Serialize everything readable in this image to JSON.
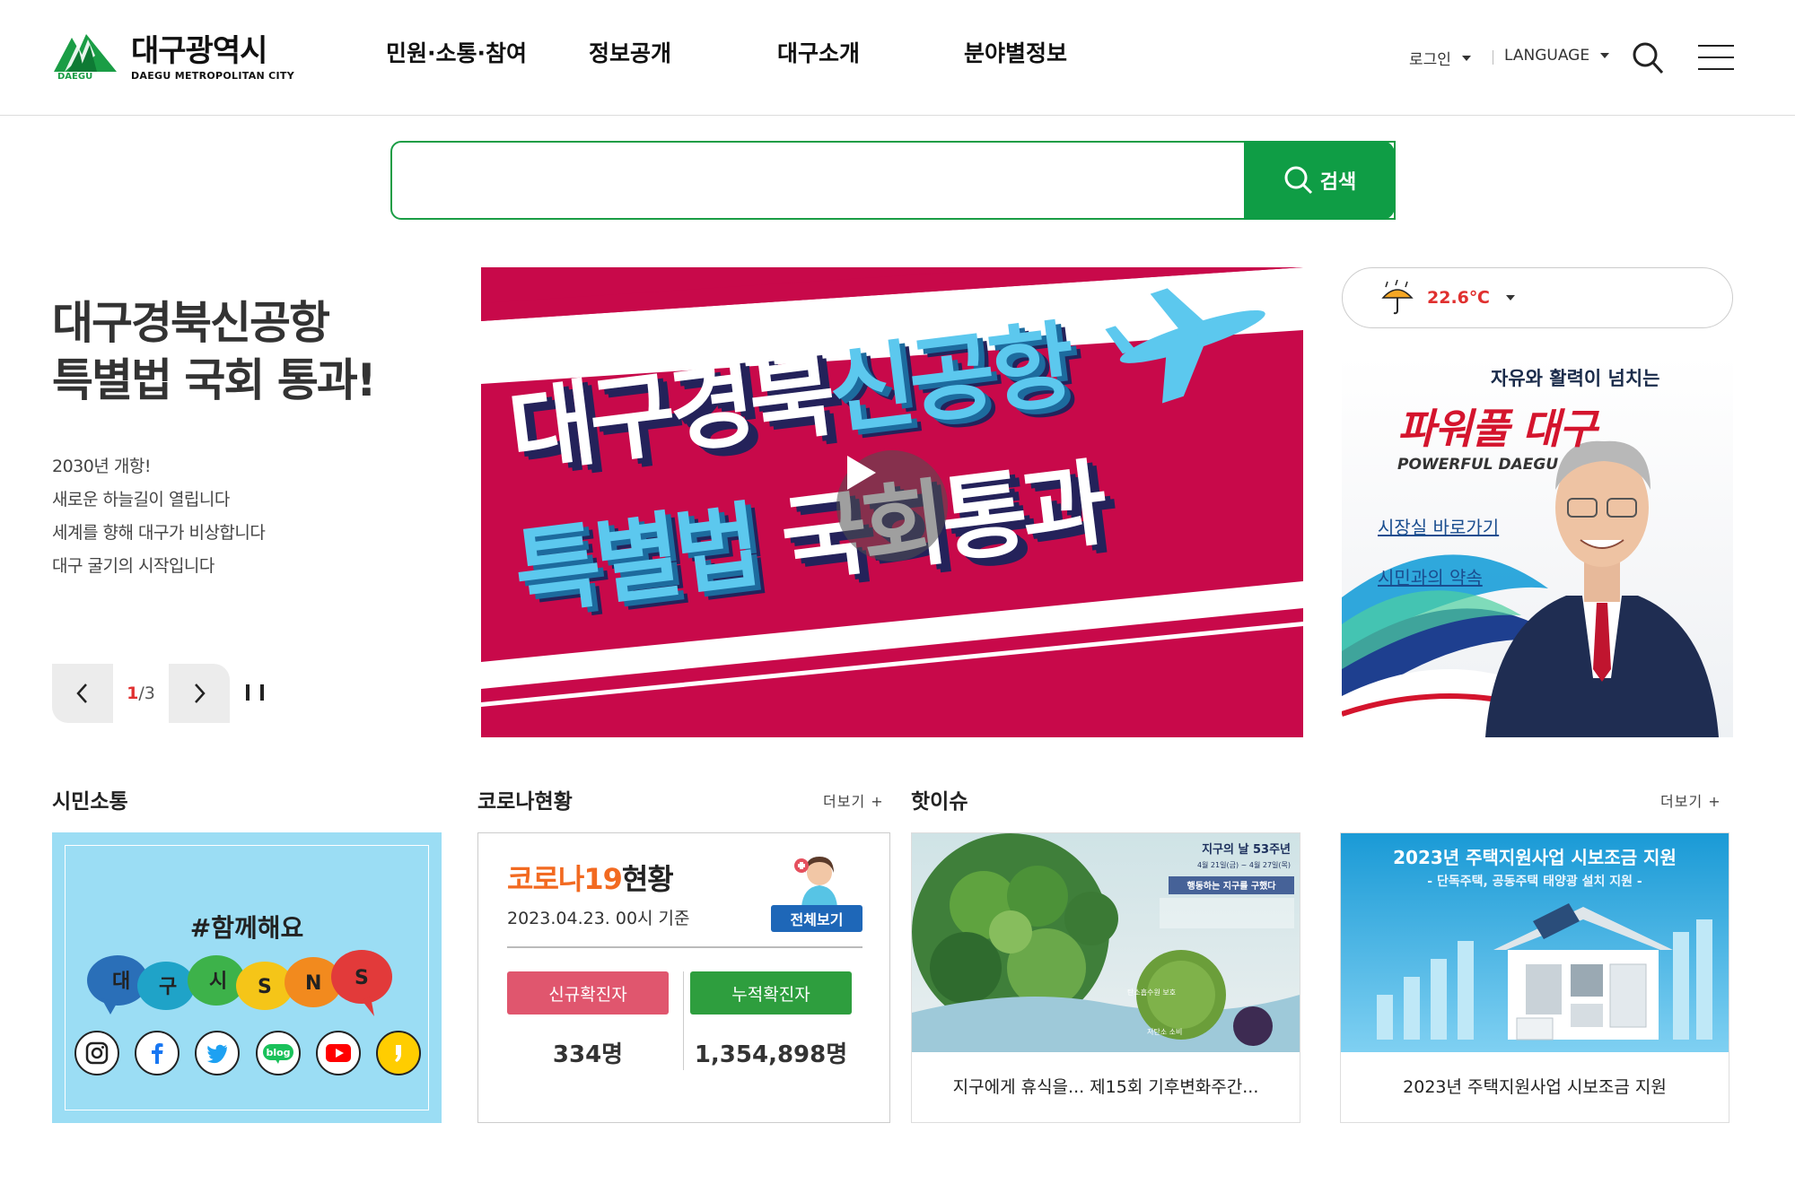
{
  "header": {
    "logo_ko": "대구광역시",
    "logo_en": "DAEGU METROPOLITAN CITY",
    "logo_mark_text": "DAEGU",
    "nav": [
      "민원·소통·참여",
      "정보공개",
      "대구소개",
      "분야별정보"
    ],
    "login_label": "로그인",
    "language_label": "LANGUAGE"
  },
  "search": {
    "placeholder": "",
    "value": "",
    "button_label": "검색"
  },
  "hero": {
    "title_line1": "대구경북신공항",
    "title_line2": "특별법 국회 통과!",
    "desc": [
      "2030년 개항!",
      "새로운 하늘길이 열립니다",
      "세계를 향해 대구가 비상합니다",
      "대구 굴기의 시작입니다"
    ],
    "slide_current": "1",
    "slide_total": "/3"
  },
  "banner": {
    "line1_a": "대구경북",
    "line1_b": "신공항",
    "line2_a": "특별법",
    "line2_b": "국회통과"
  },
  "weather": {
    "temp": "22.6℃",
    "icon": "umbrella-rain-icon"
  },
  "mayor": {
    "subtitle": "자유와 활력이 넘치는",
    "title": "파워풀 대구",
    "title_en": "POWERFUL DAEGU",
    "link1": "시장실 바로가기",
    "link2": "시민과의 약속"
  },
  "sections": {
    "sns_title": "시민소통",
    "covid_title": "코로나현황",
    "issue_title": "핫이슈",
    "more_label": "더보기 +"
  },
  "sns": {
    "hashtag": "#함께해요",
    "bubbles": [
      "대",
      "구",
      "시",
      "S",
      "N",
      "S"
    ],
    "icons": [
      "instagram-icon",
      "facebook-icon",
      "twitter-icon",
      "blog-icon",
      "youtube-icon",
      "kakao-story-icon"
    ],
    "blog_text": "blog"
  },
  "covid": {
    "title_a": "코로나19",
    "title_b": "현황",
    "date": "2023.04.23. 00시 기준",
    "view_all": "전체보기",
    "new_label": "신규확진자",
    "new_value": "334명",
    "total_label": "누적확진자",
    "total_value": "1,354,898명",
    "colors": {
      "new": "#e0566e",
      "total": "#2e9e3e"
    }
  },
  "issues": [
    {
      "caption": "지구에게 휴식을... 제15회 기후변화주간...",
      "img_title": "지구의 날 53주년",
      "img_sub": "4월 21일(금) ~ 4월 27일(목)",
      "img_tag": "행동하는 지구를 구했다",
      "img_label1": "탄소흡수원 보호",
      "img_label2": "저탄소 소비"
    },
    {
      "caption": "2023년 주택지원사업 시보조금 지원",
      "img_title": "2023년 주택지원사업 시보조금 지원",
      "img_sub": "- 단독주택, 공동주택 태양광 설치 지원 -"
    }
  ],
  "colors": {
    "brand_green": "#0f9d45",
    "banner_red": "#c8094a",
    "accent_red": "#e0302f"
  }
}
